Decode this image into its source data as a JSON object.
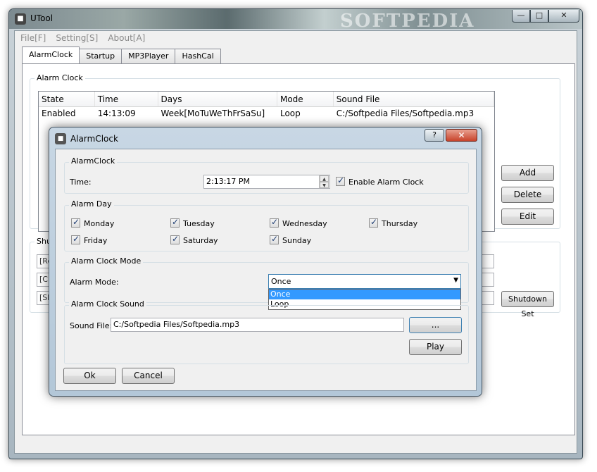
{
  "main": {
    "title": "UTool",
    "watermark": "SOFTPEDIA",
    "window_controls": {
      "minimize": "—",
      "maximize": "□",
      "close": "✕"
    },
    "menu": [
      "File[F]",
      "Setting[S]",
      "About[A]"
    ],
    "tabs": [
      "AlarmClock",
      "Startup",
      "MP3Player",
      "HashCal"
    ],
    "alarm_group_label": "Alarm Clock",
    "list": {
      "columns": [
        "State",
        "Time",
        "Days",
        "Mode",
        "Sound File"
      ],
      "rows": [
        [
          "Enabled",
          "14:13:09",
          "Week[MoTuWeThFrSaSu]",
          "Loop",
          "C:/Softpedia Files/Softpedia.mp3"
        ]
      ]
    },
    "buttons": {
      "add": "Add",
      "delete": "Delete",
      "edit": "Edit",
      "shutdown_set": "Shutdown Set"
    },
    "shutdown_group_label": "Shu",
    "shutdown_fields": [
      "[Re",
      "[Cl",
      "[Sh"
    ]
  },
  "dialog": {
    "title": "AlarmClock",
    "help": "?",
    "close": "✕",
    "alarm_clock_group": {
      "label": "AlarmClock",
      "time_label": "Time:",
      "time_value": "2:13:17 PM",
      "enable_label": "Enable Alarm Clock",
      "enabled": true
    },
    "alarm_day_group": {
      "label": "Alarm Day",
      "days": [
        {
          "name": "Monday",
          "checked": true
        },
        {
          "name": "Tuesday",
          "checked": true
        },
        {
          "name": "Wednesday",
          "checked": true
        },
        {
          "name": "Thursday",
          "checked": true
        },
        {
          "name": "Friday",
          "checked": true
        },
        {
          "name": "Saturday",
          "checked": true
        },
        {
          "name": "Sunday",
          "checked": true
        }
      ]
    },
    "mode_group": {
      "label": "Alarm Clock Mode",
      "mode_label": "Alarm Mode:",
      "selected": "Once",
      "options": [
        "Once",
        "Loop"
      ]
    },
    "sound_group": {
      "label": "Alarm Clock Sound",
      "file_label": "Sound File:",
      "file_value": "C:/Softpedia Files/Softpedia.mp3",
      "browse": "...",
      "play": "Play"
    },
    "ok": "Ok",
    "cancel": "Cancel"
  }
}
